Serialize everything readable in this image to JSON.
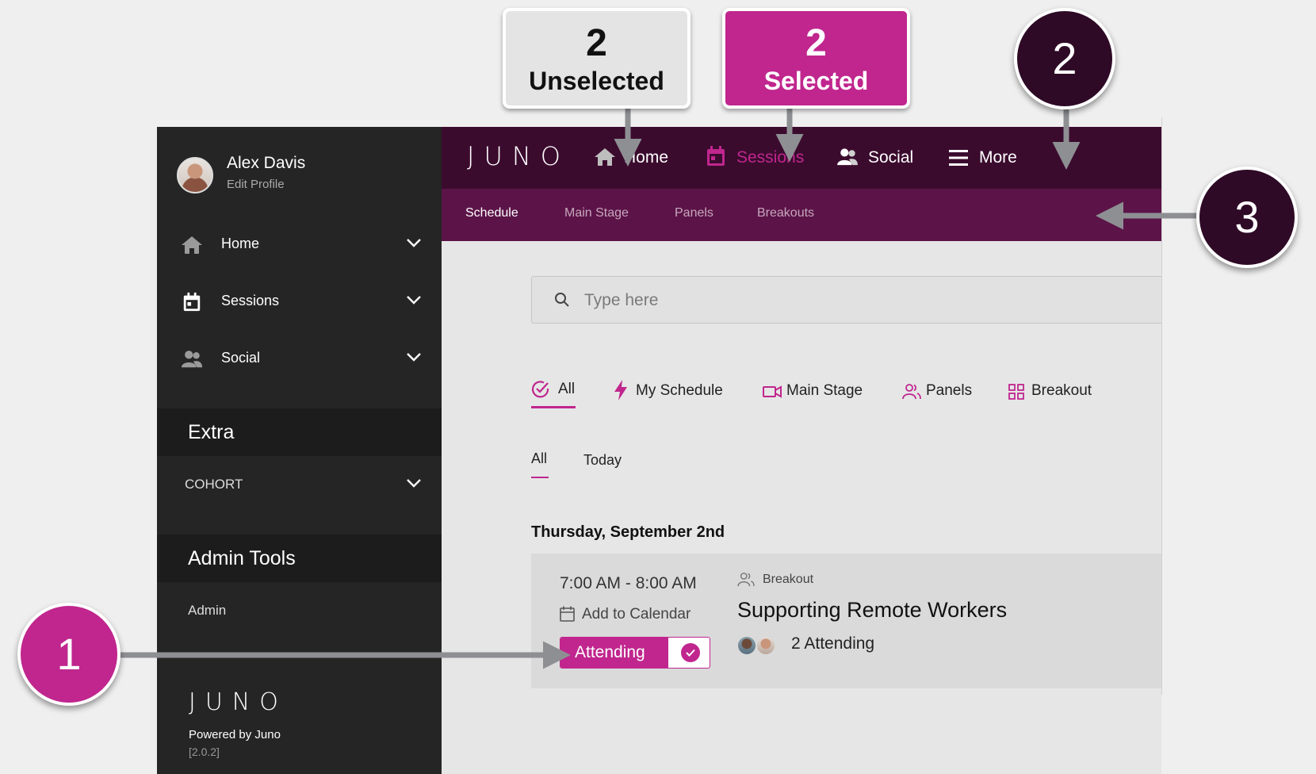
{
  "sidebar": {
    "user_name": "Alex Davis",
    "user_sub": "Edit Profile",
    "nav": [
      {
        "label": "Home",
        "icon": "home-icon"
      },
      {
        "label": "Sessions",
        "icon": "calendar-icon"
      },
      {
        "label": "Social",
        "icon": "people-icon"
      }
    ],
    "extra_heading": "Extra",
    "cohort_label": "COHORT",
    "admin_heading": "Admin Tools",
    "admin_item": "Admin",
    "brand": "JUNO",
    "powered_by": "Powered by Juno",
    "version": "[2.0.2]"
  },
  "topbar": {
    "brand": "JUNO",
    "items": [
      {
        "label": "Home",
        "icon": "home-icon"
      },
      {
        "label": "Sessions",
        "icon": "calendar-icon",
        "selected": true
      },
      {
        "label": "Social",
        "icon": "people-icon"
      },
      {
        "label": "More",
        "icon": "menu-icon"
      }
    ]
  },
  "subnav": {
    "items": [
      {
        "label": "Schedule",
        "active": true
      },
      {
        "label": "Main Stage"
      },
      {
        "label": "Panels"
      },
      {
        "label": "Breakouts"
      }
    ]
  },
  "search": {
    "placeholder": "Type here",
    "value": ""
  },
  "filters": {
    "tabs": [
      {
        "label": "All",
        "icon": "check-circle-icon",
        "active": true
      },
      {
        "label": "My Schedule",
        "icon": "lightning-icon"
      },
      {
        "label": "Main Stage",
        "icon": "video-icon"
      },
      {
        "label": "Panels",
        "icon": "people-outline-icon"
      },
      {
        "label": "Breakout",
        "icon": "grid-icon"
      }
    ],
    "date_tabs": [
      {
        "label": "All",
        "active": true
      },
      {
        "label": "Today"
      }
    ]
  },
  "schedule": {
    "date_heading": "Thursday, September 2nd",
    "sessions": [
      {
        "time": "7:00 AM - 8:00 AM",
        "add_to_calendar": "Add to Calendar",
        "attend_label": "Attending",
        "type": "Breakout",
        "title": "Supporting Remote Workers",
        "attending": "2 Attending"
      }
    ]
  },
  "annotations": {
    "unselected": {
      "number": "2",
      "text": "Unselected"
    },
    "selected": {
      "number": "2",
      "text": "Selected"
    },
    "circle_nav": "2",
    "circle_subnav": "3",
    "circle_attend": "1"
  },
  "colors": {
    "accent": "#c0268e",
    "topbar": "#3b0b2e",
    "subbar": "#5c1448",
    "sidebar": "#252525",
    "circle_dark": "#2e0a26"
  }
}
